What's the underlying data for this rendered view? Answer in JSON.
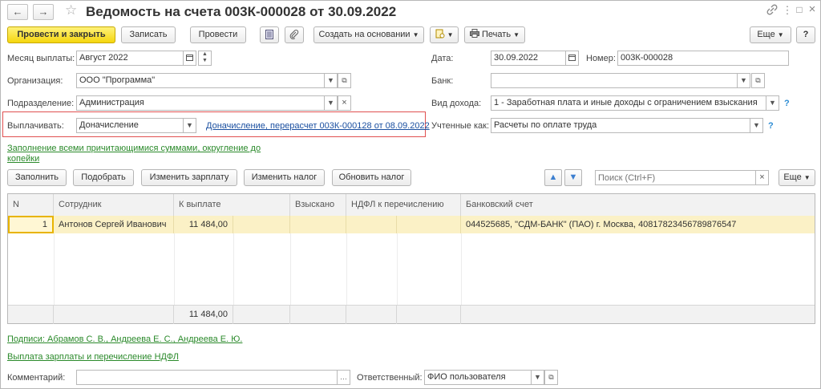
{
  "header": {
    "title": "Ведомость на счета 003К-000028 от 30.09.2022",
    "back_icon": "←",
    "forward_icon": "→",
    "star_icon": "☆",
    "link_icon": "🔗",
    "menu_icon": "⋮",
    "maximize_icon": "□",
    "close_icon": "×"
  },
  "toolbar": {
    "post_close": "Провести и закрыть",
    "save": "Записать",
    "post": "Провести",
    "create_based": "Создать на основании",
    "print": "Печать",
    "more": "Еще",
    "help": "?"
  },
  "form": {
    "month_label": "Месяц выплаты:",
    "month_value": "Август 2022",
    "org_label": "Организация:",
    "org_value": "ООО \"Программа\"",
    "dept_label": "Подразделение:",
    "dept_value": "Администрация",
    "pay_label": "Выплачивать:",
    "pay_value": "Доначисление",
    "pay_link": "Доначисление, перерасчет 003К-000128 от 08.09.2022",
    "date_label": "Дата:",
    "date_value": "30.09.2022",
    "number_label": "Номер:",
    "number_value": "003К-000028",
    "bank_label": "Банк:",
    "bank_value": "",
    "income_label": "Вид дохода:",
    "income_value": "1 - Заработная плата и иные доходы с ограничением взыскания",
    "account_label": "Учтенные как:",
    "account_value": "Расчеты по оплате труда",
    "fill_link": "Заполнение всеми причитающимися суммами, округление до копейки",
    "fill_link_line1": "Заполнение всеми причитающимися суммами, округление до",
    "fill_link_line2": "копейки"
  },
  "table_toolbar": {
    "fill": "Заполнить",
    "select": "Подобрать",
    "change_salary": "Изменить зарплату",
    "change_tax": "Изменить налог",
    "update_tax": "Обновить налог",
    "search_placeholder": "Поиск (Ctrl+F)",
    "more": "Еще"
  },
  "table": {
    "columns": [
      "N",
      "Сотрудник",
      "К выплате",
      "Взыскано",
      "НДФЛ к перечислению",
      "Банковский счет"
    ],
    "rows": [
      {
        "n": "1",
        "employee": "Антонов Сергей Иванович",
        "amount": "11 484,00",
        "withheld": "",
        "ndfl": "",
        "bank_account": "044525685, \"СДМ-БАНК\" (ПАО) г. Москва, 40817823456789876547"
      }
    ],
    "total_amount": "11 484,00"
  },
  "footer": {
    "signatures_link": "Подписи: Абрамов С. В., Андреева Е. С., Андреева Е. Ю.",
    "payout_link": "Выплата зарплаты и перечисление НДФЛ",
    "comment_label": "Комментарий:",
    "comment_value": "",
    "responsible_label": "Ответственный:",
    "responsible_value": "ФИО пользователя"
  },
  "colors": {
    "primary_button": "#f5d60e",
    "selected_row": "#fbf1c6",
    "link": "#1a4fa0",
    "green_link": "#2b8a2b",
    "highlight_border": "#e05050"
  }
}
